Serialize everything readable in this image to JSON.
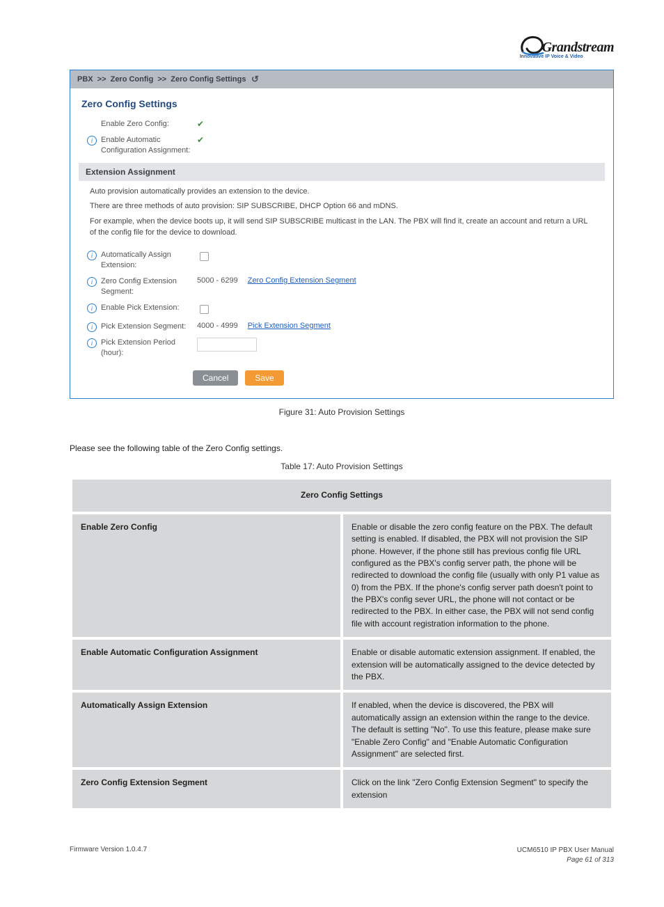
{
  "logo": {
    "word": "Grandstream",
    "tagline": "Innovative IP Voice & Video"
  },
  "breadcrumb": {
    "l1": "PBX",
    "l2": "Zero Config",
    "l3": "Zero Config Settings"
  },
  "section": {
    "title": "Zero Config Settings"
  },
  "fields": {
    "enable_zero_config": {
      "label": "Enable Zero Config:",
      "checked": true
    },
    "enable_auto_conf": {
      "label": "Enable Automatic Configuration Assignment:",
      "checked": true
    },
    "ext_assign_header": "Extension Assignment",
    "auto_assign_ext": {
      "label": "Automatically Assign Extension:",
      "checked": false
    },
    "zero_seg": {
      "label": "Zero Config Extension Segment:",
      "range": "5000 - 6299",
      "link": "Zero Config Extension Segment"
    },
    "enable_pick": {
      "label": "Enable Pick Extension:",
      "checked": false
    },
    "pick_seg": {
      "label": "Pick Extension Segment:",
      "range": "4000 - 4999",
      "link": "Pick Extension Segment"
    },
    "pick_period": {
      "label": "Pick Extension Period (hour):"
    }
  },
  "notes": {
    "p1": "Auto provision automatically provides an extension to the device.",
    "p2": "There are three methods of auto provision: SIP SUBSCRIBE, DHCP Option 66 and mDNS.",
    "p3": "For example, when the device boots up, it will send SIP SUBSCRIBE multicast in the LAN. The PBX will find it, create an account and return a URL of the config file for the device to download."
  },
  "buttons": {
    "cancel": "Cancel",
    "save": "Save"
  },
  "figure": {
    "caption": "Figure 31: Auto Provision Settings"
  },
  "post_text": "Please see the following table of the Zero Config settings.",
  "table": {
    "caption": "Table 17: Auto Provision Settings",
    "header": "Zero Config Settings",
    "rows": [
      {
        "l": "Enable Zero Config",
        "r": "Enable or disable the zero config feature on the PBX. The default setting is enabled. If disabled, the PBX will not provision the SIP phone. However, if the phone still has previous config file URL configured as the PBX's config server path, the phone will be redirected to download the config file (usually with only P1 value as 0) from the PBX. If the phone's config server path doesn't point to the PBX's config sever URL, the phone will not contact or be redirected to the PBX. In either case, the PBX will not send config file with account registration information to the phone."
      },
      {
        "l": "Enable Automatic Configuration Assignment",
        "r": "Enable or disable automatic extension assignment. If enabled, the extension will be automatically assigned to the device detected by the PBX."
      },
      {
        "l": "Automatically Assign Extension",
        "r": "If enabled, when the device is discovered, the PBX will automatically assign an extension within the range to the device. The default is setting \"No\". To use this feature, please make sure \"Enable Zero Config\" and \"Enable Automatic Configuration Assignment\" are selected first."
      },
      {
        "l": "Zero Config Extension Segment",
        "r": "Click on the link \"Zero Config Extension Segment\" to specify the extension"
      }
    ]
  },
  "footer": {
    "left": "Firmware Version 1.0.4.7",
    "right_1": "UCM6510 IP PBX User Manual",
    "right_2": "Page 61 of 313"
  }
}
